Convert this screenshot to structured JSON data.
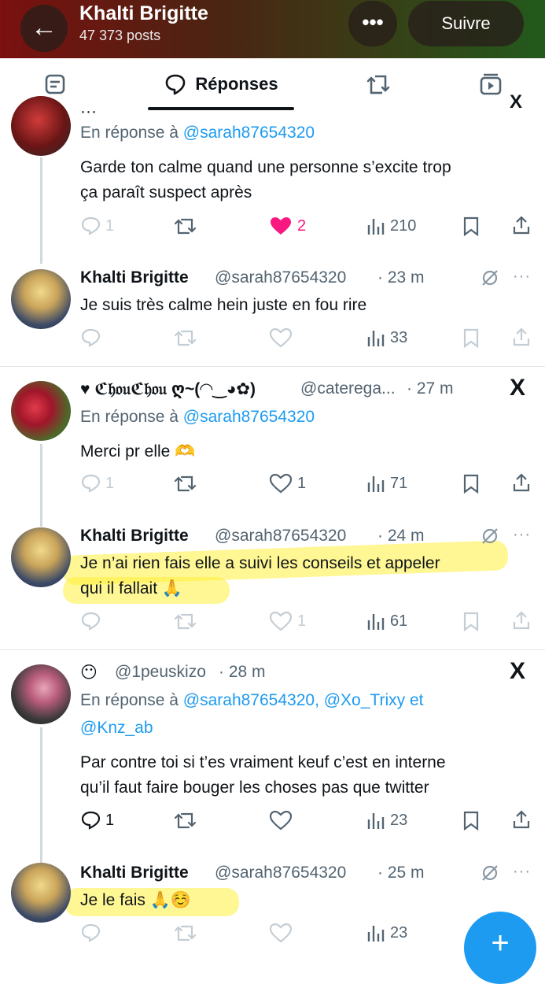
{
  "header": {
    "title": "Khalti Brigitte",
    "posts": "47 373 posts",
    "back_icon": "←",
    "more_icon": "•••",
    "follow_label": "Suivre"
  },
  "tabs": {
    "active_label": "Réponses"
  },
  "replies": [
    {
      "handle_partial": "···",
      "reply_prefix": "En réponse à",
      "reply_to": "@sarah87654320",
      "text": [
        "Garde ton calme quand une personne s’excite trop",
        "ça paraît suspect après"
      ],
      "stats": {
        "replies": "1",
        "likes": "2",
        "views": "210"
      }
    },
    {
      "name": "Khalti Brigitte",
      "handle": "@sarah87654320",
      "time": "· 23 m",
      "text": [
        "Je suis très calme hein juste en fou rire"
      ],
      "stats": {
        "views": "33"
      }
    },
    {
      "name": "♥ ℭ𝔥𝔬𝔲ℭ𝔥𝔬𝔲 ღ~(◠‿◕✿)",
      "handle": "@caterega...",
      "time": "· 27 m",
      "reply_prefix": "En réponse à",
      "reply_to": "@sarah87654320",
      "text": [
        "Merci pr elle 🫶"
      ],
      "stats": {
        "replies": "1",
        "likes": "1",
        "views": "71"
      }
    },
    {
      "name": "Khalti Brigitte",
      "handle": "@sarah87654320",
      "time": "· 24 m",
      "text": [
        "Je n’ai rien fais elle a suivi les conseils et appeler",
        "qui il fallait 🙏"
      ],
      "stats": {
        "likes": "1",
        "views": "61"
      }
    },
    {
      "name": "😶",
      "handle": "@1peuskizo",
      "time": "· 28 m",
      "reply_prefix": "En réponse à",
      "reply_to": "@sarah87654320, @Xo_Trixy et",
      "reply_to_2": "@Knz_ab",
      "text": [
        "Par contre toi si t’es vraiment keuf c’est en interne",
        "qu’il faut faire bouger les choses pas que twitter"
      ],
      "stats": {
        "replies": "1",
        "views": "23"
      }
    },
    {
      "name": "Khalti Brigitte",
      "handle": "@sarah87654320",
      "time": "· 25 m",
      "text": [
        "Je le fais 🙏☺️"
      ],
      "stats": {
        "views": "23"
      }
    }
  ],
  "fab_icon": "+"
}
